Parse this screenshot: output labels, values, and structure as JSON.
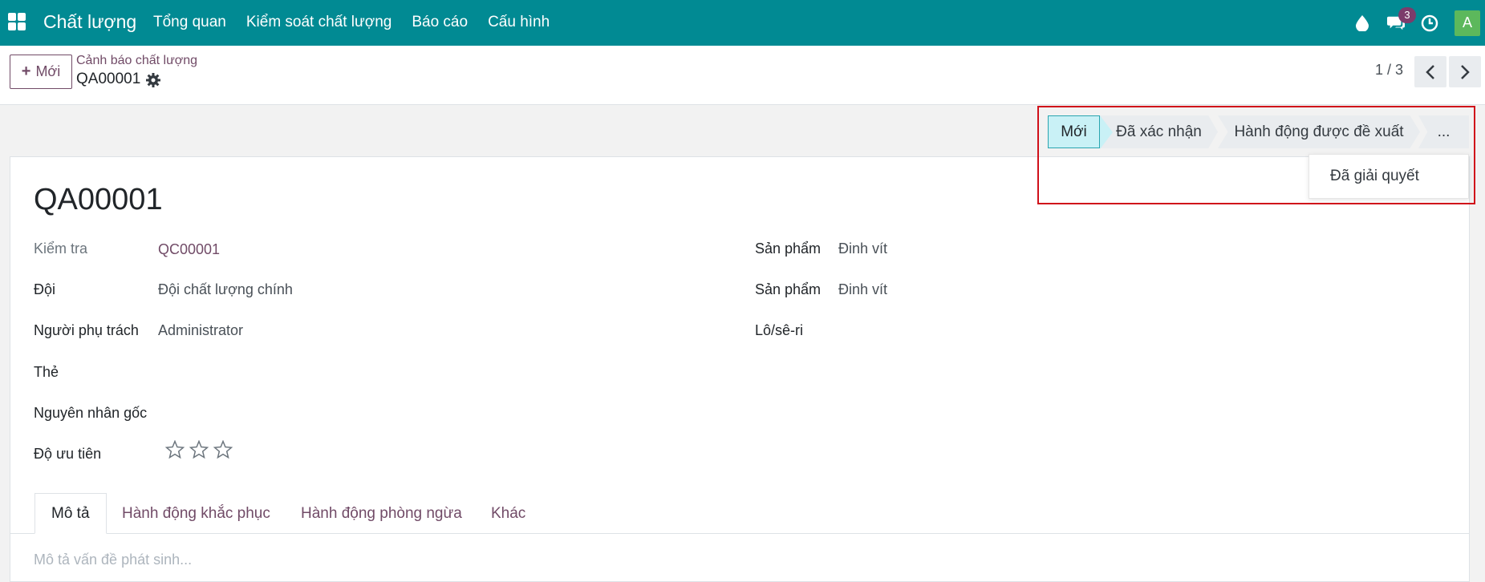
{
  "navbar": {
    "brand": "Chất lượng",
    "menu": [
      "Tổng quan",
      "Kiểm soát chất lượng",
      "Báo cáo",
      "Cấu hình"
    ],
    "messages_count": "3",
    "avatar_initial": "A",
    "bg_color": "#018a93"
  },
  "control_panel": {
    "new_button": "Mới",
    "breadcrumb": "Cảnh báo chất lượng",
    "record_name": "QA00001",
    "pager": "1 / 3"
  },
  "statusbar": {
    "stages": [
      "Mới",
      "Đã xác nhận",
      "Hành động được đề xuất",
      "..."
    ],
    "active_stage": "Mới",
    "dropdown_item": "Đã giải quyết"
  },
  "form": {
    "title": "QA00001",
    "left": {
      "check_label": "Kiểm tra",
      "check_value": "QC00001",
      "team_label": "Đội",
      "team_value": "Đội chất lượng chính",
      "responsible_label": "Người phụ trách",
      "responsible_value": "Administrator",
      "tags_label": "Thẻ",
      "root_cause_label": "Nguyên nhân gốc",
      "priority_label": "Độ ưu tiên",
      "priority_stars": 0,
      "priority_max": 3
    },
    "right": {
      "product_label": "Sản phẩm",
      "product_value": "Đinh vít",
      "product_variant_label": "Sản phẩm",
      "product_variant_value": "Đinh vít",
      "lot_label": "Lô/sê-ri"
    },
    "tabs": [
      "Mô tả",
      "Hành động khắc phục",
      "Hành động phòng ngừa",
      "Khác"
    ],
    "description_placeholder": "Mô tả vấn đề phát sinh..."
  }
}
